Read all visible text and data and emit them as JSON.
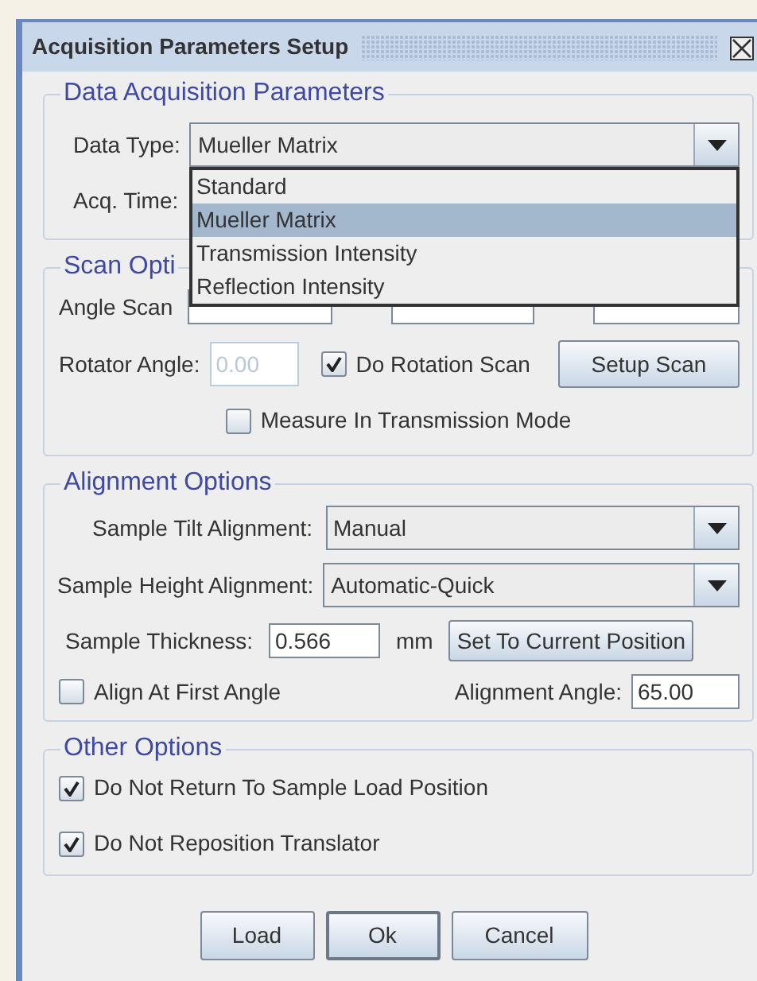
{
  "window": {
    "title": "Acquisition Parameters Setup"
  },
  "data_acquisition": {
    "title": "Data Acquisition Parameters",
    "data_type": {
      "label": "Data Type:",
      "value": "Mueller Matrix",
      "expanded": true,
      "options": [
        {
          "label": "Standard",
          "selected": false
        },
        {
          "label": "Mueller Matrix",
          "selected": true
        },
        {
          "label": "Transmission Intensity",
          "selected": false
        },
        {
          "label": "Reflection Intensity",
          "selected": false
        }
      ]
    },
    "acq_time": {
      "label": "Acq. Time:"
    }
  },
  "scan_options": {
    "title": "Scan Opti",
    "angle_scan": {
      "label": "Angle Scan"
    },
    "rotator_angle": {
      "label": "Rotator Angle:",
      "value": "0.00",
      "disabled": true
    },
    "do_rotation_scan": {
      "label": "Do Rotation Scan",
      "checked": true
    },
    "setup_button": "Setup Scan",
    "measure_transmission": {
      "label": "Measure In Transmission Mode",
      "checked": false
    }
  },
  "alignment": {
    "title": "Alignment Options",
    "tilt": {
      "label": "Sample Tilt Alignment:",
      "value": "Manual"
    },
    "height": {
      "label": "Sample Height Alignment:",
      "value": "Automatic-Quick"
    },
    "thickness": {
      "label": "Sample Thickness:",
      "value": "0.566",
      "unit": "mm"
    },
    "set_button": "Set To Current Position",
    "first_angle": {
      "label": "Align At First Angle",
      "checked": false
    },
    "angle": {
      "label": "Alignment Angle:",
      "value": "65.00"
    }
  },
  "other_options": {
    "title": "Other Options",
    "items": [
      {
        "label": "Do Not Return To Sample Load Position",
        "checked": true
      },
      {
        "label": "Do Not Reposition Translator",
        "checked": true
      }
    ]
  },
  "buttons": [
    {
      "label": "Load",
      "default": false
    },
    {
      "label": "Ok",
      "default": true
    },
    {
      "label": "Cancel",
      "default": false
    }
  ]
}
